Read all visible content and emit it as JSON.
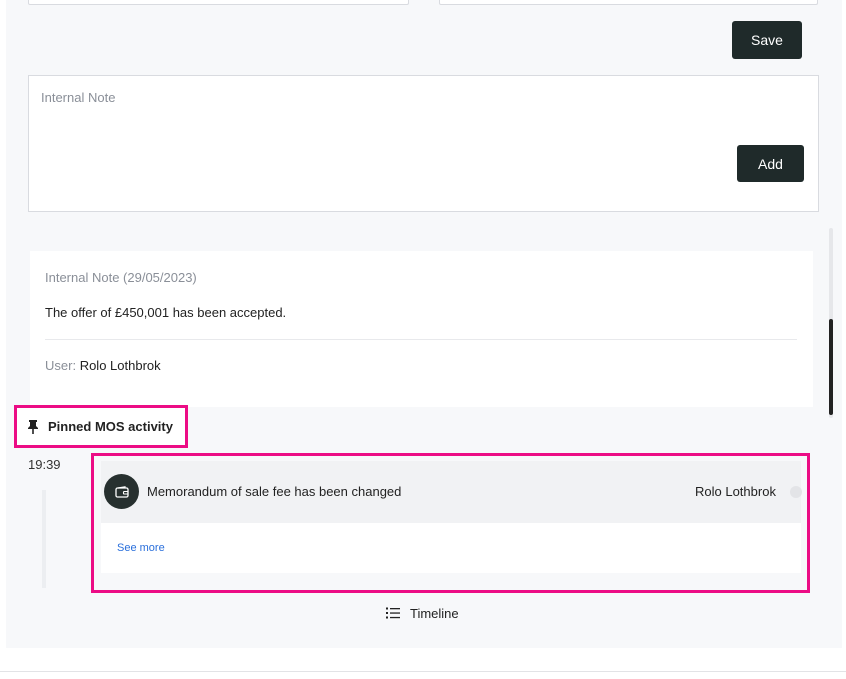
{
  "form": {
    "save_label": "Save"
  },
  "internal_note_input": {
    "placeholder": "Internal Note",
    "add_label": "Add"
  },
  "note_card": {
    "title": "Internal Note (29/05/2023)",
    "body": "The offer of £450,001 has been accepted.",
    "user_label": "User:",
    "user_name": "Rolo Lothbrok"
  },
  "pinned": {
    "label": "Pinned MOS activity",
    "icon": "pin-icon"
  },
  "activity": {
    "time": "19:39",
    "icon": "wallet-icon",
    "message": "Memorandum of sale fee has been changed",
    "user": "Rolo Lothbrok",
    "see_more": "See more"
  },
  "footer": {
    "timeline_label": "Timeline",
    "timeline_icon": "list-icon"
  },
  "colors": {
    "highlight": "#ec0c85",
    "button_dark": "#1f2a2a",
    "link": "#2a6fdb"
  }
}
